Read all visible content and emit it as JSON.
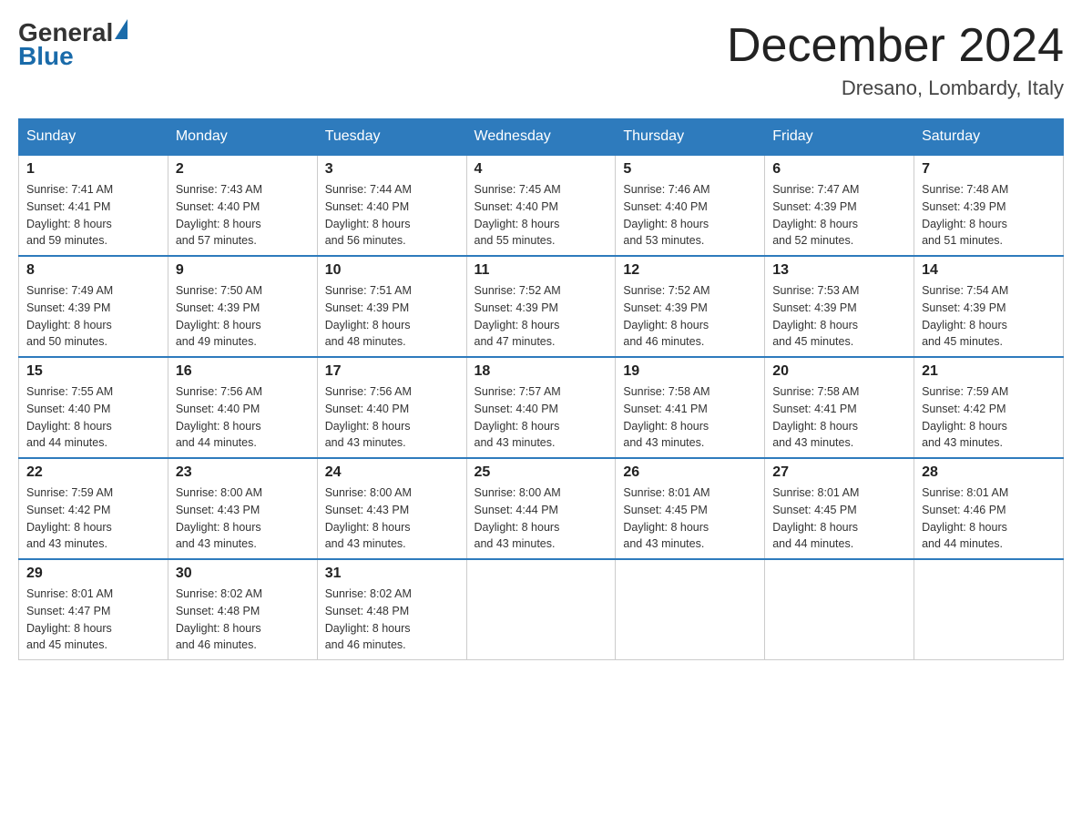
{
  "header": {
    "logo_general": "General",
    "logo_blue": "Blue",
    "month_title": "December 2024",
    "location": "Dresano, Lombardy, Italy"
  },
  "days_of_week": [
    "Sunday",
    "Monday",
    "Tuesday",
    "Wednesday",
    "Thursday",
    "Friday",
    "Saturday"
  ],
  "weeks": [
    [
      {
        "day": "1",
        "sunrise": "7:41 AM",
        "sunset": "4:41 PM",
        "daylight": "8 hours and 59 minutes."
      },
      {
        "day": "2",
        "sunrise": "7:43 AM",
        "sunset": "4:40 PM",
        "daylight": "8 hours and 57 minutes."
      },
      {
        "day": "3",
        "sunrise": "7:44 AM",
        "sunset": "4:40 PM",
        "daylight": "8 hours and 56 minutes."
      },
      {
        "day": "4",
        "sunrise": "7:45 AM",
        "sunset": "4:40 PM",
        "daylight": "8 hours and 55 minutes."
      },
      {
        "day": "5",
        "sunrise": "7:46 AM",
        "sunset": "4:40 PM",
        "daylight": "8 hours and 53 minutes."
      },
      {
        "day": "6",
        "sunrise": "7:47 AM",
        "sunset": "4:39 PM",
        "daylight": "8 hours and 52 minutes."
      },
      {
        "day": "7",
        "sunrise": "7:48 AM",
        "sunset": "4:39 PM",
        "daylight": "8 hours and 51 minutes."
      }
    ],
    [
      {
        "day": "8",
        "sunrise": "7:49 AM",
        "sunset": "4:39 PM",
        "daylight": "8 hours and 50 minutes."
      },
      {
        "day": "9",
        "sunrise": "7:50 AM",
        "sunset": "4:39 PM",
        "daylight": "8 hours and 49 minutes."
      },
      {
        "day": "10",
        "sunrise": "7:51 AM",
        "sunset": "4:39 PM",
        "daylight": "8 hours and 48 minutes."
      },
      {
        "day": "11",
        "sunrise": "7:52 AM",
        "sunset": "4:39 PM",
        "daylight": "8 hours and 47 minutes."
      },
      {
        "day": "12",
        "sunrise": "7:52 AM",
        "sunset": "4:39 PM",
        "daylight": "8 hours and 46 minutes."
      },
      {
        "day": "13",
        "sunrise": "7:53 AM",
        "sunset": "4:39 PM",
        "daylight": "8 hours and 45 minutes."
      },
      {
        "day": "14",
        "sunrise": "7:54 AM",
        "sunset": "4:39 PM",
        "daylight": "8 hours and 45 minutes."
      }
    ],
    [
      {
        "day": "15",
        "sunrise": "7:55 AM",
        "sunset": "4:40 PM",
        "daylight": "8 hours and 44 minutes."
      },
      {
        "day": "16",
        "sunrise": "7:56 AM",
        "sunset": "4:40 PM",
        "daylight": "8 hours and 44 minutes."
      },
      {
        "day": "17",
        "sunrise": "7:56 AM",
        "sunset": "4:40 PM",
        "daylight": "8 hours and 43 minutes."
      },
      {
        "day": "18",
        "sunrise": "7:57 AM",
        "sunset": "4:40 PM",
        "daylight": "8 hours and 43 minutes."
      },
      {
        "day": "19",
        "sunrise": "7:58 AM",
        "sunset": "4:41 PM",
        "daylight": "8 hours and 43 minutes."
      },
      {
        "day": "20",
        "sunrise": "7:58 AM",
        "sunset": "4:41 PM",
        "daylight": "8 hours and 43 minutes."
      },
      {
        "day": "21",
        "sunrise": "7:59 AM",
        "sunset": "4:42 PM",
        "daylight": "8 hours and 43 minutes."
      }
    ],
    [
      {
        "day": "22",
        "sunrise": "7:59 AM",
        "sunset": "4:42 PM",
        "daylight": "8 hours and 43 minutes."
      },
      {
        "day": "23",
        "sunrise": "8:00 AM",
        "sunset": "4:43 PM",
        "daylight": "8 hours and 43 minutes."
      },
      {
        "day": "24",
        "sunrise": "8:00 AM",
        "sunset": "4:43 PM",
        "daylight": "8 hours and 43 minutes."
      },
      {
        "day": "25",
        "sunrise": "8:00 AM",
        "sunset": "4:44 PM",
        "daylight": "8 hours and 43 minutes."
      },
      {
        "day": "26",
        "sunrise": "8:01 AM",
        "sunset": "4:45 PM",
        "daylight": "8 hours and 43 minutes."
      },
      {
        "day": "27",
        "sunrise": "8:01 AM",
        "sunset": "4:45 PM",
        "daylight": "8 hours and 44 minutes."
      },
      {
        "day": "28",
        "sunrise": "8:01 AM",
        "sunset": "4:46 PM",
        "daylight": "8 hours and 44 minutes."
      }
    ],
    [
      {
        "day": "29",
        "sunrise": "8:01 AM",
        "sunset": "4:47 PM",
        "daylight": "8 hours and 45 minutes."
      },
      {
        "day": "30",
        "sunrise": "8:02 AM",
        "sunset": "4:48 PM",
        "daylight": "8 hours and 46 minutes."
      },
      {
        "day": "31",
        "sunrise": "8:02 AM",
        "sunset": "4:48 PM",
        "daylight": "8 hours and 46 minutes."
      },
      null,
      null,
      null,
      null
    ]
  ]
}
